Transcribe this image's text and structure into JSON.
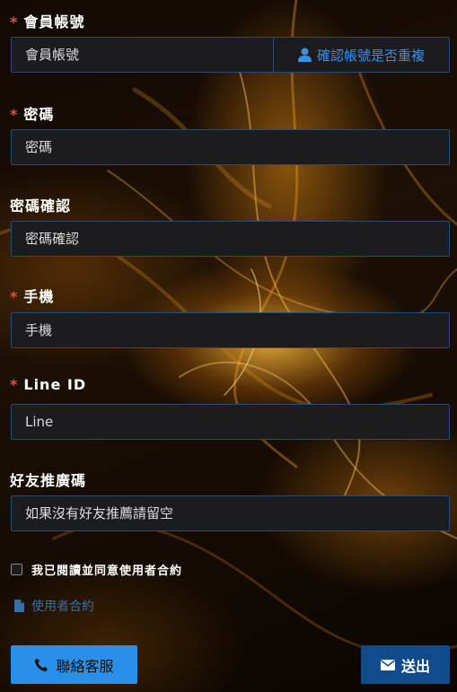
{
  "fields": {
    "account": {
      "label": "會員帳號",
      "required": true,
      "placeholder": "會員帳號"
    },
    "password": {
      "label": "密碼",
      "required": true,
      "placeholder": "密碼"
    },
    "password_confirm": {
      "label": "密碼確認",
      "required": false,
      "placeholder": "密碼確認"
    },
    "phone": {
      "label": "手機",
      "required": true,
      "placeholder": "手機"
    },
    "line_id": {
      "label": "Line ID",
      "required": true,
      "placeholder": "Line"
    },
    "referral": {
      "label": "好友推廣碼",
      "required": false,
      "placeholder": "如果沒有好友推薦請留空"
    }
  },
  "required_marker": "*",
  "check_account_button": {
    "label": "確認帳號是否重複",
    "icon": "user-icon"
  },
  "agree_checkbox": {
    "label": "我已閱讀並同意使用者合約",
    "checked": false
  },
  "terms_link": {
    "label": "使用者合約",
    "icon": "file-icon"
  },
  "contact_button": {
    "label": "聯絡客服",
    "icon": "phone-icon"
  },
  "submit_button": {
    "label": "送出",
    "icon": "envelope-icon"
  },
  "colors": {
    "required": "#e0533d",
    "field_bg": "#1c1c1f",
    "field_border": "#2a4a6e",
    "link": "#3d8fe0",
    "contact_bg": "#2a8fe8",
    "submit_bg": "#104c8c"
  }
}
